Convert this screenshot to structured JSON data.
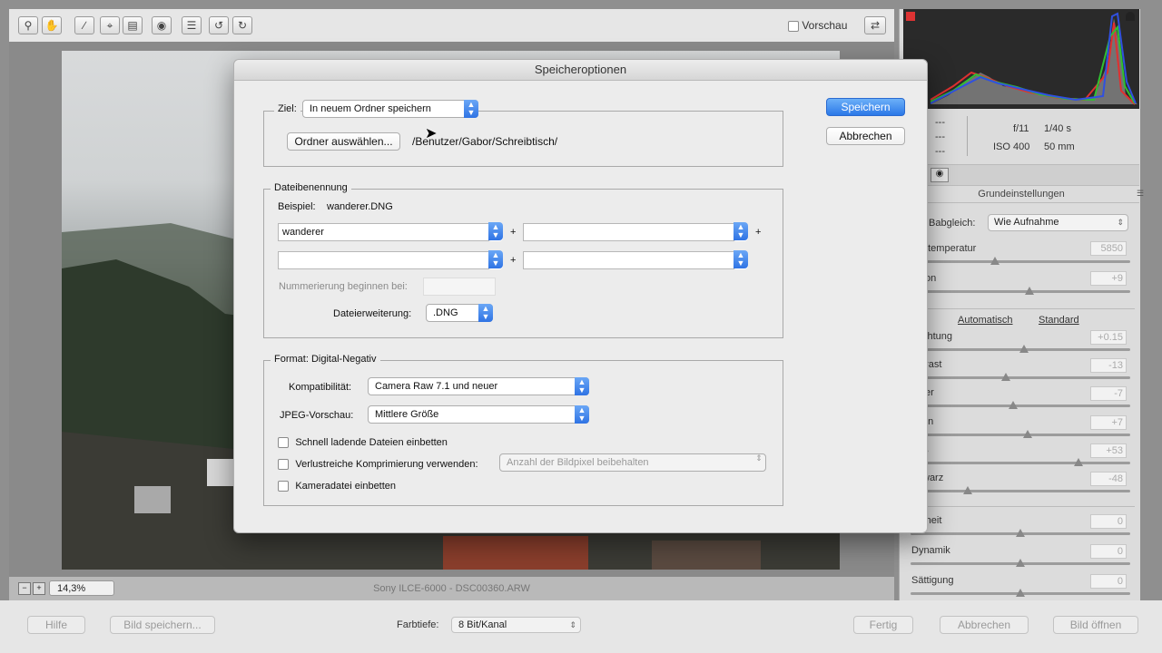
{
  "toolbar": {
    "tools": [
      "zoom-icon",
      "hand-icon",
      "eyedropper-icon",
      "crop-icon",
      "straighten-icon",
      "redeye-icon",
      "presets-icon",
      "rotate-left-icon",
      "rotate-right-icon"
    ],
    "preview_label": "Vorschau"
  },
  "status": {
    "zoom": "14,3%",
    "camera_file": "Sony ILCE-6000 - DSC00360.ARW"
  },
  "camera_info": {
    "dash1": "---",
    "dash2": "---",
    "dash3": "---",
    "aperture": "f/11",
    "shutter": "1/40 s",
    "iso": "ISO 400",
    "focal": "50 mm"
  },
  "panel": {
    "title": "Grundeinstellungen",
    "wb_label": "Babgleich:",
    "wb_value": "Wie Aufnahme",
    "temp_label": "btemperatur",
    "temp_value": "5850",
    "tint_label": "ton",
    "tint_value": "+9",
    "auto_link": "Automatisch",
    "default_link": "Standard",
    "exposure_label": "chtung",
    "exposure_value": "+0.15",
    "contrast_label": "trast",
    "contrast_value": "-13",
    "highlights_label": "ter",
    "highlights_value": "-7",
    "shadows_label": "en",
    "shadows_value": "+7",
    "whites_label": "ß",
    "whites_value": "+53",
    "blacks_label": "warz",
    "blacks_value": "-48",
    "clarity_label": "rheit",
    "clarity_value": "0",
    "vibrance_label": "Dynamik",
    "vibrance_value": "0",
    "saturation_label": "Sättigung",
    "saturation_value": "0"
  },
  "bottom": {
    "help_button": "Hilfe",
    "save_image_button": "Bild speichern...",
    "depth_label": "Farbtiefe:",
    "depth_value": "8 Bit/Kanal",
    "done_button": "Fertig",
    "cancel_button": "Abbrechen",
    "open_button": "Bild öffnen"
  },
  "dialog": {
    "title": "Speicheroptionen",
    "save_button": "Speichern",
    "cancel_button": "Abbrechen",
    "target_label": "Ziel:",
    "target_value": "In neuem Ordner speichern",
    "choose_folder_button": "Ordner auswählen...",
    "folder_path": "/Benutzer/Gabor/Schreibtisch/",
    "naming_legend": "Dateibenennung",
    "example_label": "Beispiel:",
    "example_value": "wanderer.DNG",
    "name_field1": "wanderer",
    "name_field2": "",
    "name_field3": "",
    "name_field4": "",
    "plus": "+",
    "numbering_label": "Nummerierung beginnen bei:",
    "numbering_value": "",
    "extension_label": "Dateierweiterung:",
    "extension_value": ".DNG",
    "format_label": "Format:",
    "format_value": "Digital-Negativ",
    "compat_label": "Kompatibilität:",
    "compat_value": "Camera Raw 7.1 und neuer",
    "jpeg_label": "JPEG-Vorschau:",
    "jpeg_value": "Mittlere Größe",
    "fastload_label": "Schnell ladende Dateien einbetten",
    "lossy_label": "Verlustreiche Komprimierung verwenden:",
    "lossy_value": "Anzahl der Bildpixel beibehalten",
    "embed_raw_label": "Kameradatei einbetten"
  }
}
